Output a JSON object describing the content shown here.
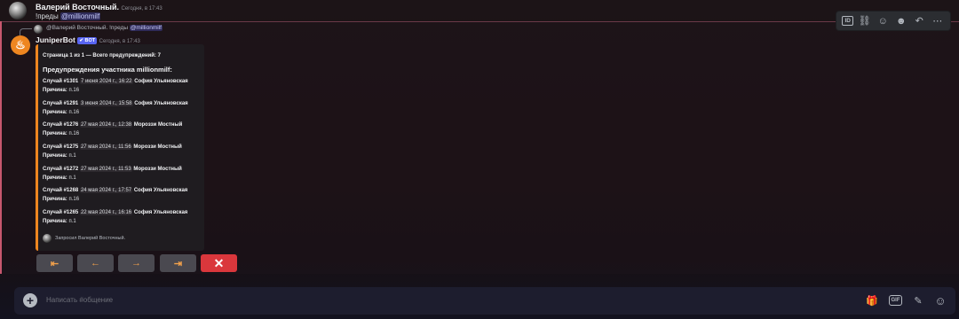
{
  "message1": {
    "author": "Валерий Восточный.",
    "timestamp": "Сегодня, в 17:43",
    "command": "!преды",
    "mention": "@millionmilf"
  },
  "reply": {
    "author": "@Валерий Восточный.",
    "text": "!преды",
    "mention": "@millionmilf"
  },
  "bot": {
    "avatar_glyph": "♨",
    "name": "JuniperBot",
    "tag": "✔ BOT",
    "timestamp": "Сегодня, в 17:43"
  },
  "embed": {
    "accent_color": "#ee8620",
    "page_info": "Страница 1 из 1 — Всего предупреждений: 7",
    "title": "Предупреждения участника millionmilf:",
    "reason_label": "Причина:",
    "cases": [
      {
        "case": "Случай #1301",
        "date": "7 июня 2024 г., 16:22",
        "moderator": "София Ульяновская",
        "reason": "п.16"
      },
      {
        "case": "Случай #1291",
        "date": "3 июня 2024 г., 15:58",
        "moderator": "София Ульяновская",
        "reason": "п.16"
      },
      {
        "case": "Случай #1276",
        "date": "27 мая 2024 г., 12:38",
        "moderator": "Мороззи Мостный",
        "reason": "п.16"
      },
      {
        "case": "Случай #1275",
        "date": "27 мая 2024 г., 11:56",
        "moderator": "Мороззи Мостный",
        "reason": "п.1"
      },
      {
        "case": "Случай #1272",
        "date": "27 мая 2024 г., 11:53",
        "moderator": "Мороззи Мостный",
        "reason": "п.1"
      },
      {
        "case": "Случай #1268",
        "date": "24 мая 2024 г., 17:57",
        "moderator": "София Ульяновская",
        "reason": "п.16"
      },
      {
        "case": "Случай #1265",
        "date": "22 мая 2024 г., 16:16",
        "moderator": "София Ульяновская",
        "reason": "п.1"
      }
    ],
    "footer": "Запросил Валерий Восточный."
  },
  "buttons": {
    "first": "⇤",
    "prev": "←",
    "next": "→",
    "last": "⇥",
    "close": "✕"
  },
  "toolbar": {
    "id_label": "ID",
    "link_icon": "⛓",
    "react_icon": "☺",
    "emoji_icon": "☻",
    "reply_icon": "↶",
    "more_icon": "⋯"
  },
  "composer": {
    "placeholder": "Написать #общение",
    "gift_icon": "🎁",
    "gif_label": "GIF",
    "sticker_icon": "✎",
    "emoji_icon": "☺"
  }
}
